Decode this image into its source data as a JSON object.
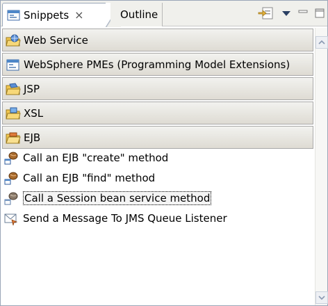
{
  "tabs": [
    {
      "label": "Snippets",
      "close": "×",
      "active": true
    },
    {
      "label": "Outline",
      "active": false
    }
  ],
  "toolbar": {
    "icons": [
      "insert-snippet-icon",
      "view-menu-icon",
      "minimize-icon",
      "maximize-icon"
    ]
  },
  "drawers": [
    {
      "label": "Web Service",
      "icon": "drawer-web-service-icon"
    },
    {
      "label": "WebSphere PMEs (Programming Model Extensions)",
      "icon": "drawer-folder-icon"
    },
    {
      "label": "JSP",
      "icon": "drawer-folder-icon"
    },
    {
      "label": "XSL",
      "icon": "drawer-folder-icon"
    },
    {
      "label": "EJB",
      "icon": "drawer-folder-open-icon"
    }
  ],
  "entries": [
    {
      "label": "Call an EJB \"create\" method",
      "icon": "ejb-bean-icon"
    },
    {
      "label": "Call an EJB \"find\" method",
      "icon": "ejb-bean-icon"
    },
    {
      "label": "Call a Session bean service method",
      "icon": "ejb-bean-icon",
      "selected": true
    },
    {
      "label": "Send a Message To JMS Queue Listener",
      "icon": "jms-message-icon"
    }
  ]
}
